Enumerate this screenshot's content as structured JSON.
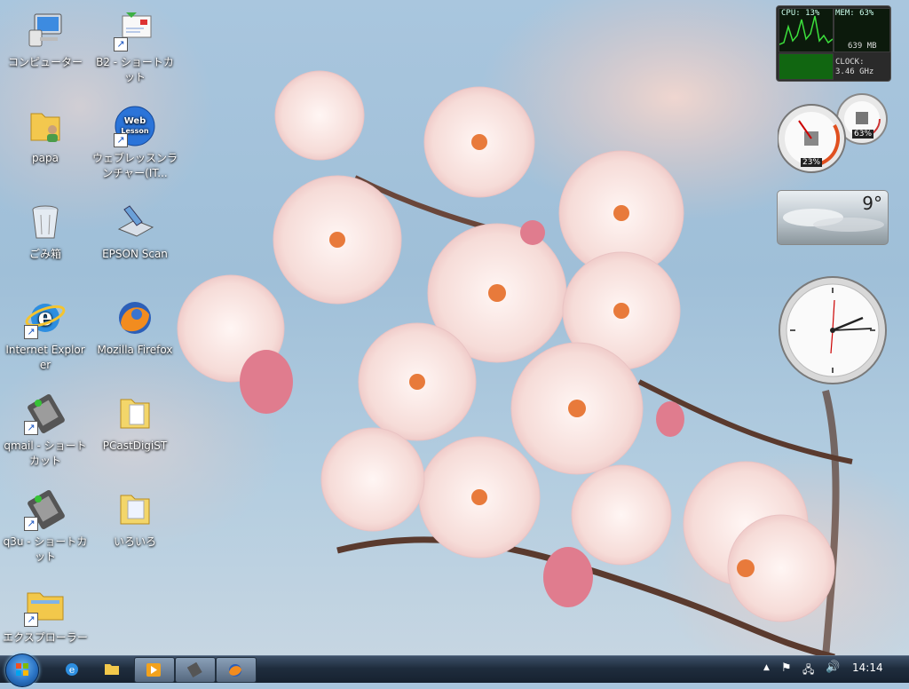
{
  "desktop": {
    "icons": [
      {
        "label": "コンピューター"
      },
      {
        "label": "B2 - ショートカット"
      },
      {
        "label": "papa"
      },
      {
        "label": "ウェブレッスンランチャー(IT..."
      },
      {
        "label": "ごみ箱"
      },
      {
        "label": "EPSON Scan"
      },
      {
        "label": "Internet Explorer"
      },
      {
        "label": "Mozilla Firefox"
      },
      {
        "label": "qmail - ショートカット"
      },
      {
        "label": "PCastDigiST"
      },
      {
        "label": "q3u - ショートカット"
      },
      {
        "label": "いろいろ"
      },
      {
        "label": "エクスプローラー"
      }
    ],
    "web_icon_text": "Web Lesson"
  },
  "gadgets": {
    "meter": {
      "cpu_label": "CPU: 13%",
      "mem_label": "MEM: 63%",
      "mem_value": "639 MB",
      "clock_label": "CLOCK:",
      "clock_value": "3.46 GHz"
    },
    "gauge": {
      "cpu_percent": "23%",
      "mem_percent": "63%"
    },
    "weather": {
      "temperature": "9°"
    }
  },
  "taskbar": {
    "time": "14:14"
  },
  "colors": {
    "taskbar": "#1f2d3e",
    "accent": "#2a73c4"
  }
}
